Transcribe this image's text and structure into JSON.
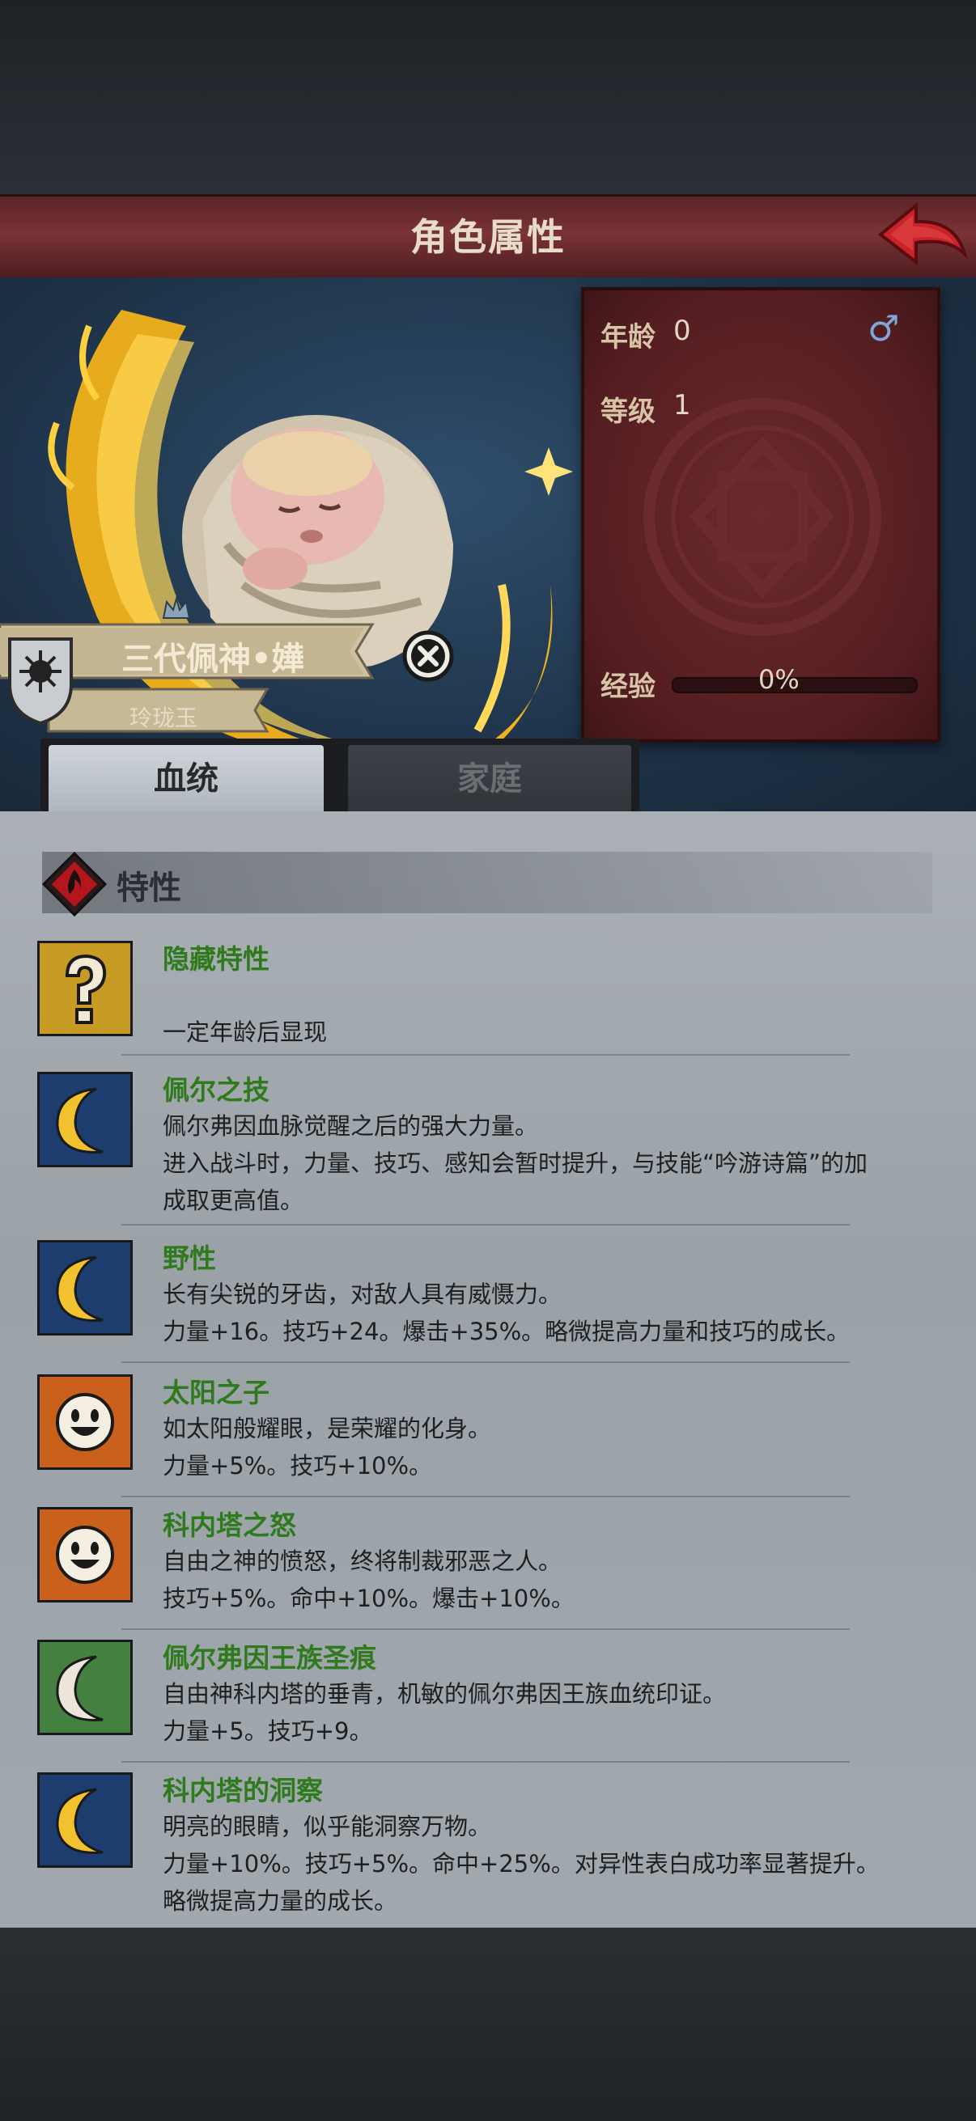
{
  "header": {
    "title": "角色属性"
  },
  "character": {
    "name": "三代佩神•嬅",
    "subtitle": "玲珑玉"
  },
  "stats": {
    "age_label": "年龄",
    "age_value": "0",
    "level_label": "等级",
    "level_value": "1",
    "exp_label": "经验",
    "exp_value": "0%",
    "exp_fraction": 0,
    "gender_icon": "male-icon",
    "gender_symbol": "♂"
  },
  "tabs": [
    {
      "label": "血统",
      "active": true
    },
    {
      "label": "家庭",
      "active": false
    }
  ],
  "traits_section": {
    "title": "特性"
  },
  "traits": [
    {
      "name": "隐藏特性",
      "icon": "question-icon",
      "lines": [
        "",
        "一定年龄后显现"
      ]
    },
    {
      "name": "佩尔之技",
      "icon": "crescent-moon-icon",
      "lines": [
        "佩尔弗因血脉觉醒之后的强大力量。",
        "进入战斗时，力量、技巧、感知会暂时提升，与技能“吟游诗篇”的加",
        "成取更高值。"
      ]
    },
    {
      "name": "野性",
      "icon": "crescent-moon-icon",
      "lines": [
        "长有尖锐的牙齿，对敌人具有威慑力。",
        "力量+16。技巧+24。爆击+35%。略微提高力量和技巧的成长。"
      ]
    },
    {
      "name": "太阳之子",
      "icon": "sun-face-icon",
      "lines": [
        "如太阳般耀眼，是荣耀的化身。",
        "力量+5%。技巧+10%。"
      ]
    },
    {
      "name": "科内塔之怒",
      "icon": "sun-face-icon",
      "lines": [
        "自由之神的愤怒，终将制裁邪恶之人。",
        "技巧+5%。命中+10%。爆击+10%。"
      ]
    },
    {
      "name": "佩尔弗因王族圣痕",
      "icon": "white-crescent-icon",
      "lines": [
        "自由神科内塔的垂青，机敏的佩尔弗因王族血统印证。",
        "力量+5。技巧+9。"
      ]
    },
    {
      "name": "科内塔的洞察",
      "icon": "crescent-moon-icon",
      "lines": [
        "明亮的眼睛，似乎能洞察万物。",
        "力量+10%。技巧+5%。命中+25%。对异性表白成功率显著提升。",
        "略微提高力量的成长。"
      ]
    }
  ],
  "colors": {
    "trait_name": "#2f7a1c",
    "title_bar": "#7a3336",
    "card": "#561e22"
  }
}
